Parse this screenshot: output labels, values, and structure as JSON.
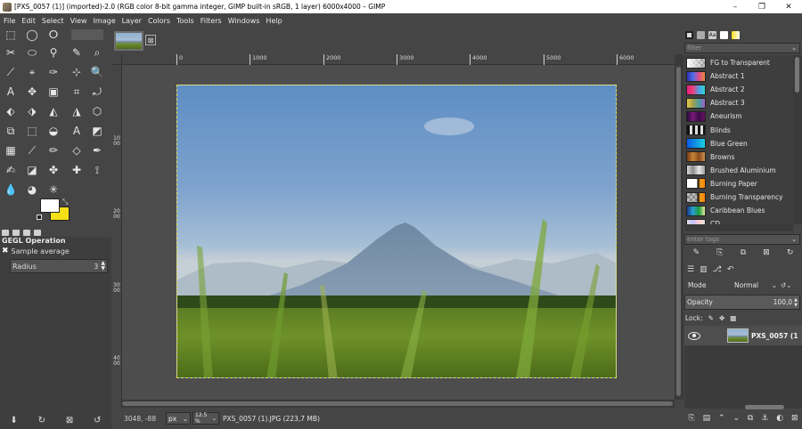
{
  "window": {
    "title": "[PXS_0057 (1)] (imported)-2.0 (RGB color 8-bit gamma integer, GIMP built-in sRGB, 1 layer) 6000x4000 – GIMP",
    "minimize": "–",
    "restore": "❐",
    "close": "✕"
  },
  "menu": [
    "File",
    "Edit",
    "Select",
    "View",
    "Image",
    "Layer",
    "Colors",
    "Tools",
    "Filters",
    "Windows",
    "Help"
  ],
  "colors": {
    "foreground": "#ffffff",
    "background": "#f5e017",
    "selection": "#e7df55"
  },
  "tool_options": {
    "header": "GEGL Operation",
    "operation": "Sample average",
    "radius_label": "Radius",
    "radius_value": "3"
  },
  "image_tab": {
    "close": "⊠"
  },
  "ruler_top": [
    "0",
    "1000",
    "2000",
    "3000",
    "4000",
    "5000",
    "6000"
  ],
  "ruler_left": [
    "1000",
    "2000",
    "3000",
    "4000"
  ],
  "status": {
    "coords": "3048, -88",
    "unit": "px",
    "zoom": "12.5 %",
    "file": "PXS_0057 (1).JPG (223,7 MB)"
  },
  "gradients": {
    "filter_placeholder": "filter",
    "tags_placeholder": "enter tags",
    "items": [
      {
        "name": "FG to Transparent",
        "swatch": "linear-gradient(90deg,#ffffff,rgba(255,255,255,0.1)),repeating-conic-gradient(#888 0 25%,#bbb 0 50%) 0 0/6px 6px"
      },
      {
        "name": "Abstract 1",
        "swatch": "linear-gradient(90deg,#2f2fb8,#4e6ee8,#e04c8c,#e88c3c)"
      },
      {
        "name": "Abstract 2",
        "swatch": "linear-gradient(90deg,#e2207a,#ef3f7a,#4fa0e8,#2fd6d0)"
      },
      {
        "name": "Abstract 3",
        "swatch": "linear-gradient(90deg,#e6c84a,#a5a04a,#4aa0a0,#a060c8)"
      },
      {
        "name": "Aneurism",
        "swatch": "linear-gradient(90deg,#2a0a3a,#7a1a7a,#3a0a4a,#6a1060)"
      },
      {
        "name": "Blinds",
        "swatch": "repeating-linear-gradient(90deg,#111 0 3px,#ddd 3px 6px)"
      },
      {
        "name": "Blue Green",
        "swatch": "linear-gradient(90deg,#0a5ae8,#1ad0e0)"
      },
      {
        "name": "Browns",
        "swatch": "linear-gradient(90deg,#7a3a12,#c8843a,#8a4a18,#d09050)"
      },
      {
        "name": "Brushed Aluminium",
        "swatch": "linear-gradient(90deg,#d8d8d8,#8a8a8a,#e8e8e8,#a0a0a0)"
      },
      {
        "name": "Burning Paper",
        "swatch": "linear-gradient(90deg,#ffffff 0 55%,#000 60%,#f0a020 75%,#ff8000)"
      },
      {
        "name": "Burning Transparency",
        "swatch": "linear-gradient(90deg,rgba(0,0,0,0) 0 55%,#000 60%,#f0a020 75%,#ff8000),repeating-conic-gradient(#888 0 25%,#bbb 0 50%) 0 0/6px 6px"
      },
      {
        "name": "Caribbean Blues",
        "swatch": "linear-gradient(90deg,#1a3a8a,#2aa0d0,#1a9a3a,#e8e8a0)"
      },
      {
        "name": "CD",
        "swatch": "linear-gradient(90deg,#e0e0e0,#c0c0ff,#ffd0d0,#e0e0e0)"
      }
    ]
  },
  "layers": {
    "mode_label": "Mode",
    "mode_value": "Normal",
    "opacity_label": "Opacity",
    "opacity_value": "100,0",
    "lock_label": "Lock:",
    "layer_name": "PXS_0057 (1"
  }
}
